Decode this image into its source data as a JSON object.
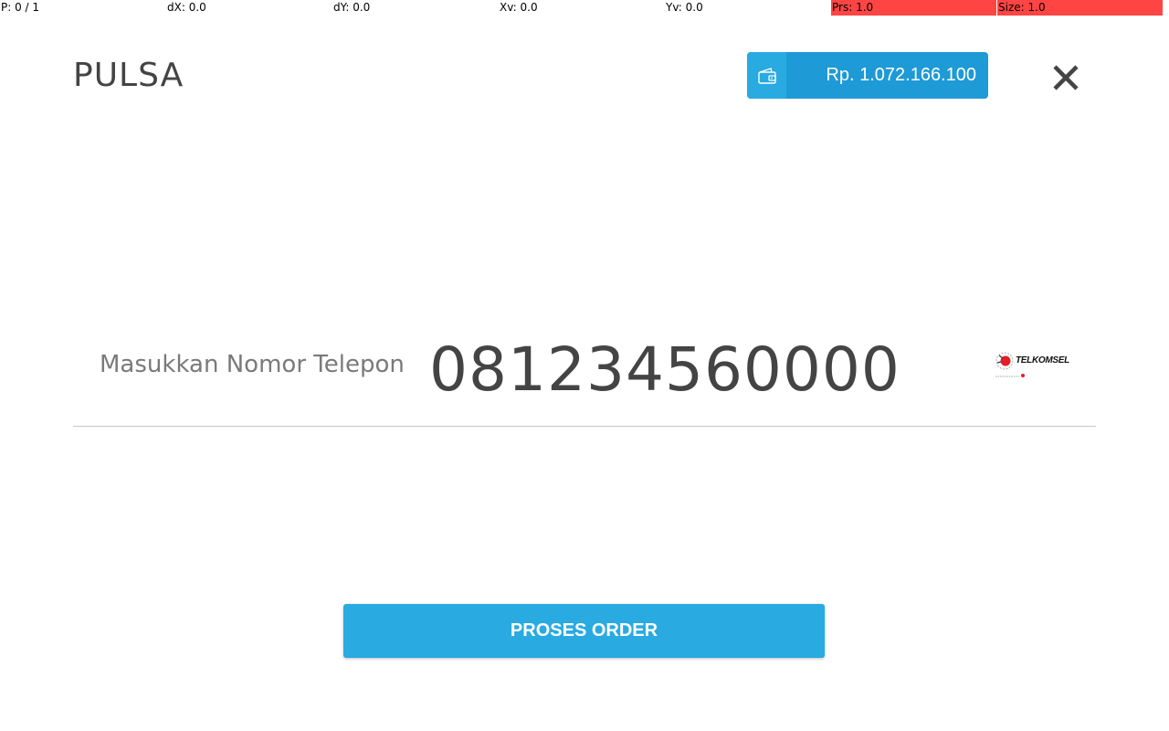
{
  "debug": {
    "pointer": "P: 0 / 1",
    "dx": "dX: 0.0",
    "dy": "dY: 0.0",
    "xv": "Xv: 0.0",
    "yv": "Yv: 0.0",
    "prs": "Prs: 1.0",
    "size": "Size: 1.0",
    "highlight_color": "#ff4444"
  },
  "header": {
    "title": "PULSA",
    "balance": "Rp. 1.072.166.100",
    "wallet_icon": "wallet-icon",
    "close_icon": "close-icon"
  },
  "form": {
    "phone_label": "Masukkan Nomor Telepon",
    "phone_value": "081234560000",
    "carrier_logo_text": "TELKOMSEL",
    "carrier_icon": "telkomsel-logo"
  },
  "actions": {
    "submit_label": "PROSES ORDER"
  },
  "colors": {
    "accent": "#29aae1",
    "accent_dark": "#1e9ad6",
    "text_primary": "#444444",
    "text_muted": "#7a7a7a"
  }
}
